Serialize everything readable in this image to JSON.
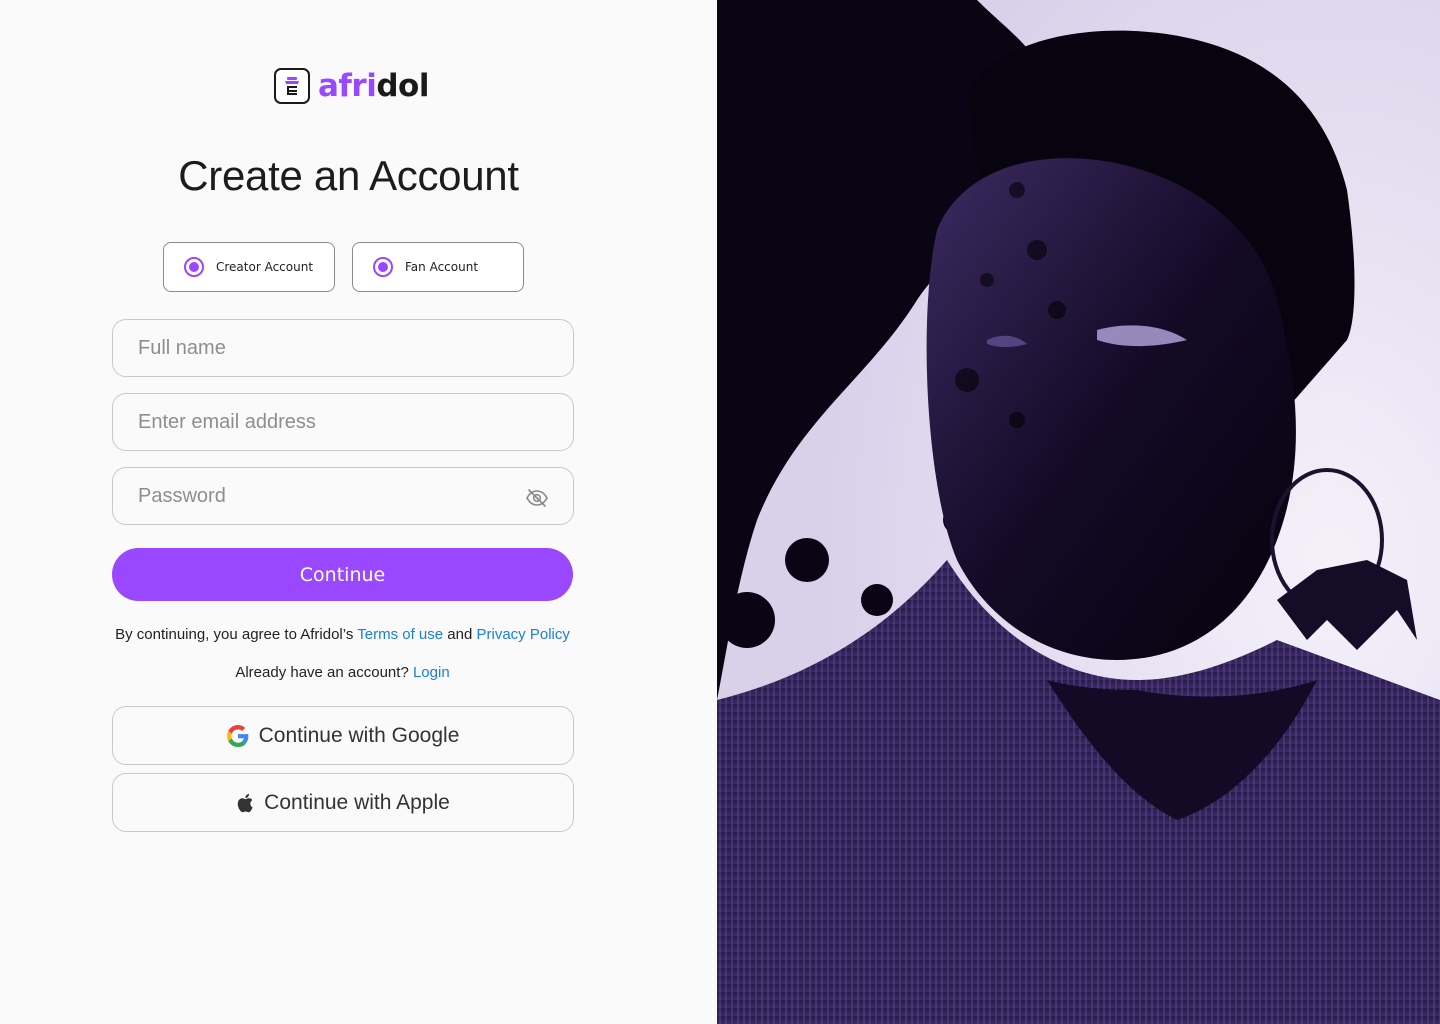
{
  "brand": {
    "name_part1": "afri",
    "name_part2": "dol",
    "accent": "#9a48ff"
  },
  "heading": "Create an Account",
  "account_types": [
    {
      "label": "Creator Account",
      "selected": true
    },
    {
      "label": "Fan Account",
      "selected": true
    }
  ],
  "form": {
    "fullname_placeholder": "Full name",
    "email_placeholder": "Enter email address",
    "password_placeholder": "Password",
    "continue_label": "Continue"
  },
  "terms": {
    "prefix": "By continuing, you agree to Afridol’s",
    "terms_link": "Terms of use",
    "and": "and",
    "privacy_link": "Privacy Policy"
  },
  "login": {
    "prompt": "Already have an account?",
    "link": "Login"
  },
  "social": {
    "google_label": "Continue with Google",
    "apple_label": "Continue with Apple"
  },
  "icons": [
    "brand-logo-icon",
    "eye-off-icon",
    "google-icon",
    "apple-icon",
    "radio-icon"
  ]
}
